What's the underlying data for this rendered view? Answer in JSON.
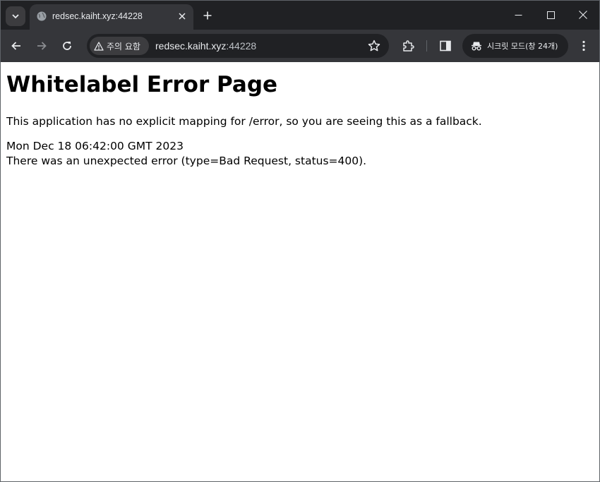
{
  "browser": {
    "tab": {
      "title": "redsec.kaiht.xyz:44228"
    },
    "omnibox": {
      "security_chip": "주의 요함",
      "host": "redsec.kaiht.xyz",
      "port": ":44228"
    },
    "incognito": {
      "label": "시크릿 모드(창 24개)"
    }
  },
  "page": {
    "heading": "Whitelabel Error Page",
    "message": "This application has no explicit mapping for /error, so you are seeing this as a fallback.",
    "timestamp": "Mon Dec 18 06:42:00 GMT 2023",
    "error_detail": "There was an unexpected error (type=Bad Request, status=400)."
  },
  "colors": {
    "titlebar": "#202124",
    "toolbar": "#35363a",
    "omnibox": "#202124",
    "text_light": "#e8eaed",
    "page_bg": "#ffffff"
  },
  "icons": {
    "tab_search": "chevron-down-icon",
    "favicon": "globe-icon",
    "tab_close": "close-icon",
    "new_tab": "plus-icon",
    "back": "arrow-left-icon",
    "forward": "arrow-right-icon",
    "reload": "reload-icon",
    "security": "warning-triangle-icon",
    "bookmark": "star-icon",
    "extensions": "puzzle-icon",
    "side_panel": "side-panel-icon",
    "incognito": "incognito-icon",
    "menu": "kebab-menu-icon"
  }
}
